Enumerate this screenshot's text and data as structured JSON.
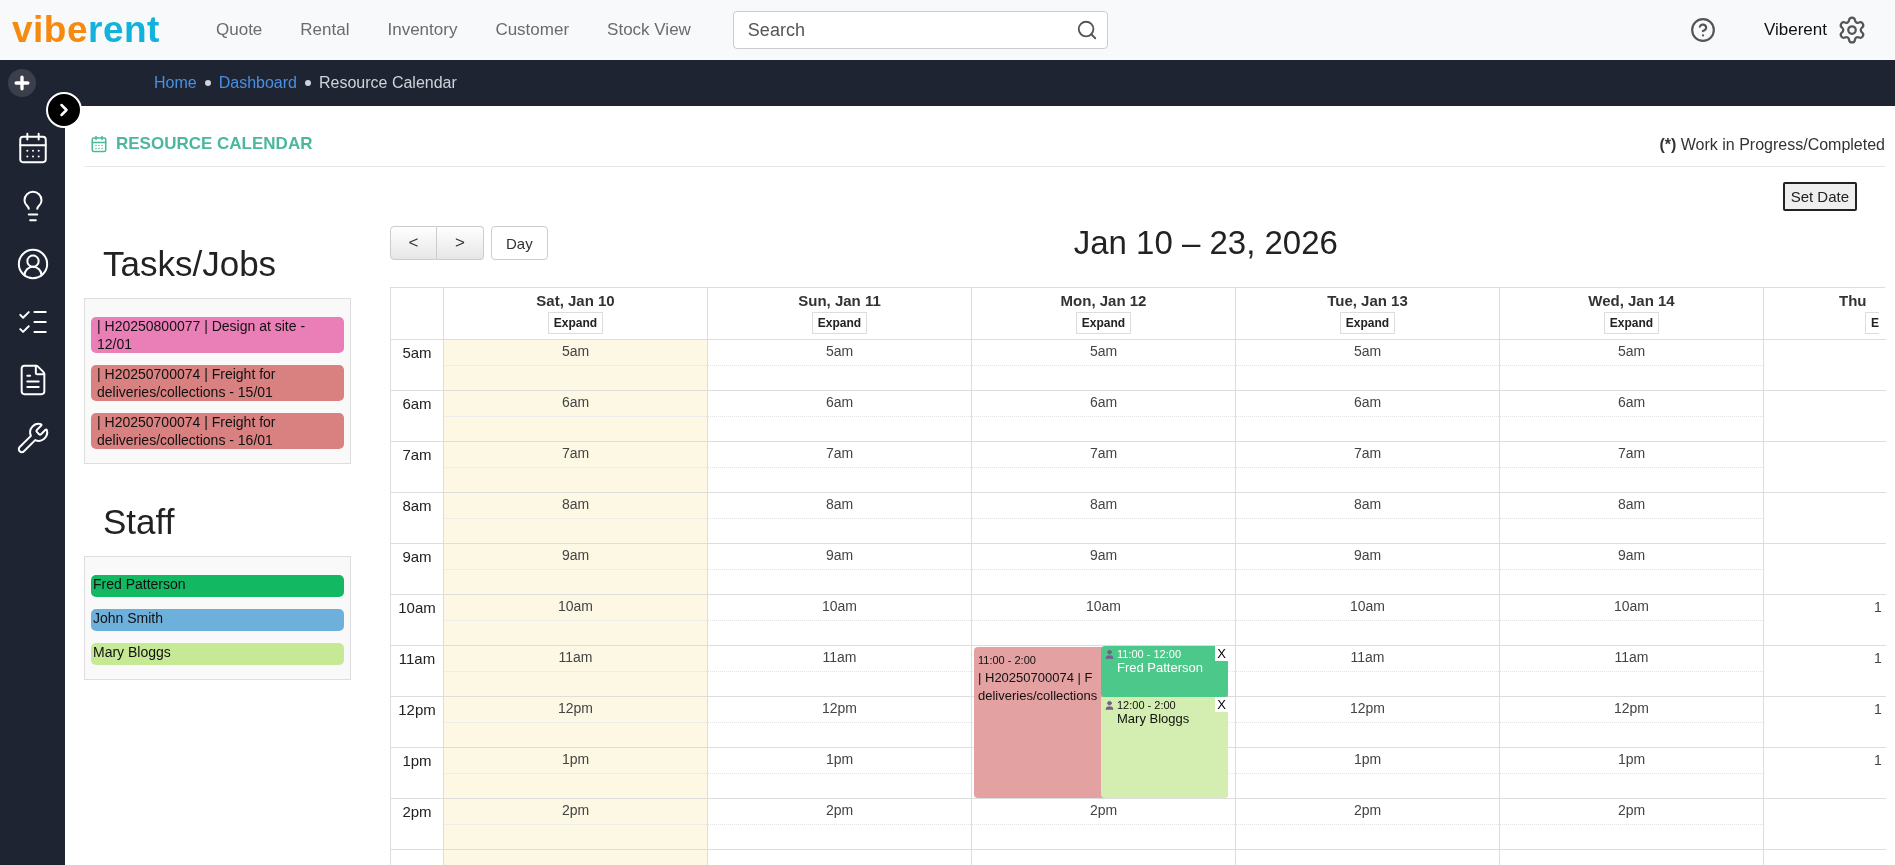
{
  "logo": {
    "parts": [
      {
        "text": "vibe",
        "color": "#f7890f"
      },
      {
        "text": "rent",
        "color": "#12b2dc"
      }
    ]
  },
  "nav": [
    "Quote",
    "Rental",
    "Inventory",
    "Customer",
    "Stock View"
  ],
  "search": {
    "placeholder": "Search"
  },
  "user": {
    "name": "Viberent"
  },
  "breadcrumb": [
    {
      "label": "Home",
      "link": true
    },
    {
      "label": "Dashboard",
      "link": true
    },
    {
      "label": "Resource Calendar",
      "link": false
    }
  ],
  "page": {
    "title": "RESOURCE CALENDAR",
    "note": "**(*)** Work in Progress/Completed",
    "set_date": "Set Date"
  },
  "tasks": {
    "heading": "Tasks/Jobs",
    "items": [
      {
        "label": "| H20250800077 | Design at site - 12/01",
        "color": "#ea7fb8"
      },
      {
        "label": "| H20250700074 | Freight for deliveries/collections - 15/01",
        "color": "#d98080"
      },
      {
        "label": "| H20250700074 | Freight for deliveries/collections - 16/01",
        "color": "#d98080"
      }
    ]
  },
  "staff": {
    "heading": "Staff",
    "items": [
      {
        "label": "Fred Patterson",
        "color": "#12b862"
      },
      {
        "label": "John Smith",
        "color": "#6eb0dc"
      },
      {
        "label": "Mary Bloggs",
        "color": "#c5e994"
      }
    ]
  },
  "calendar": {
    "prev": "<",
    "next": ">",
    "view": "Day",
    "title": "Jan 10 – 23, 2026",
    "days": [
      {
        "label": "Sat, Jan 10",
        "expand": "Expand",
        "weekend": true
      },
      {
        "label": "Sun, Jan 11",
        "expand": "Expand",
        "weekend": false
      },
      {
        "label": "Mon, Jan 12",
        "expand": "Expand",
        "weekend": false
      },
      {
        "label": "Tue, Jan 13",
        "expand": "Expand",
        "weekend": false
      },
      {
        "label": "Wed, Jan 14",
        "expand": "Expand",
        "weekend": false
      }
    ],
    "partial_day": {
      "label": "Thu",
      "expand": "E"
    },
    "rows": [
      {
        "time": "5am",
        "cells": [
          {
            "label": "5am"
          },
          {
            "label": "5am"
          },
          {
            "label": "5am"
          },
          {
            "label": "5am"
          },
          {
            "label": "5am"
          }
        ]
      },
      {
        "time": "6am",
        "cells": [
          {
            "label": "6am"
          },
          {
            "label": "6am"
          },
          {
            "label": "6am"
          },
          {
            "label": "6am"
          },
          {
            "label": "6am"
          }
        ]
      },
      {
        "time": "7am",
        "cells": [
          {
            "label": "7am"
          },
          {
            "label": "7am"
          },
          {
            "label": "7am"
          },
          {
            "label": "7am"
          },
          {
            "label": "7am"
          }
        ]
      },
      {
        "time": "8am",
        "cells": [
          {
            "label": "8am"
          },
          {
            "label": "8am"
          },
          {
            "label": "8am"
          },
          {
            "label": "8am"
          },
          {
            "label": "8am"
          }
        ]
      },
      {
        "time": "9am",
        "cells": [
          {
            "label": "9am"
          },
          {
            "label": "9am"
          },
          {
            "label": "9am"
          },
          {
            "label": "9am"
          },
          {
            "label": "9am"
          }
        ]
      },
      {
        "time": "10am",
        "cells": [
          {
            "label": "10am"
          },
          {
            "label": "10am"
          },
          {
            "label": "10am"
          },
          {
            "label": "10am"
          },
          {
            "label": "10am"
          }
        ],
        "partial": "1"
      },
      {
        "time": "11am",
        "cells": [
          {
            "label": "11am"
          },
          {
            "label": "11am"
          },
          {
            "events": [
              {
                "time": "11:00 - 2:00",
                "lines": [
                  "| H20250700074 | F",
                  "deliveries/collections"
                ],
                "color": "#e3a1a1",
                "assignments": [
                  {
                    "time": "11:00 - 12:00",
                    "name": "Fred Patterson",
                    "color": "#4cc98a",
                    "close": "X"
                  },
                  {
                    "time": "12:00 - 2:00",
                    "name": "Mary Bloggs",
                    "color": "#d3eeb0",
                    "close": "X"
                  }
                ]
              }
            ]
          },
          {
            "label": "11am"
          },
          {
            "label": "11am"
          }
        ],
        "partial": "1"
      },
      {
        "time": "12pm",
        "cells": [
          {
            "label": "12pm"
          },
          {
            "label": "12pm"
          },
          {},
          {
            "label": "12pm"
          },
          {
            "label": "12pm"
          }
        ],
        "partial": "1"
      },
      {
        "time": "1pm",
        "cells": [
          {
            "label": "1pm"
          },
          {
            "label": "1pm"
          },
          {},
          {
            "label": "1pm"
          },
          {
            "label": "1pm"
          }
        ],
        "partial": "1"
      },
      {
        "time": "2pm",
        "cells": [
          {
            "label": "2pm"
          },
          {
            "label": "2pm"
          },
          {
            "label": "2pm"
          },
          {
            "label": "2pm"
          },
          {
            "label": "2pm"
          }
        ]
      }
    ]
  }
}
